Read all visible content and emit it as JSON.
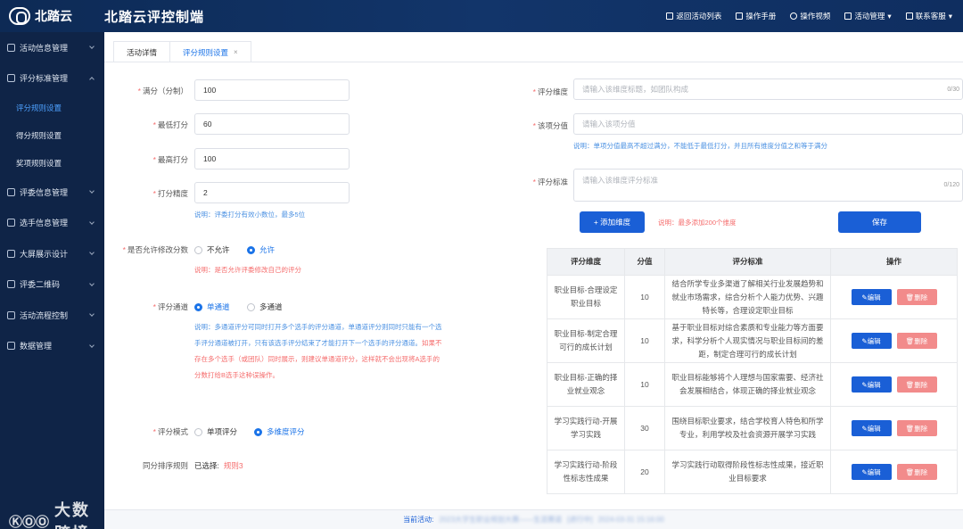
{
  "header": {
    "logo_text": "北踏云",
    "app_title": "北踏云评控制端",
    "actions": [
      {
        "label": "返回活动列表",
        "icon": "grid-icon"
      },
      {
        "label": "操作手册",
        "icon": "book-icon"
      },
      {
        "label": "操作视频",
        "icon": "play-icon"
      },
      {
        "label": "活动管理",
        "icon": "table-icon"
      },
      {
        "label": "联系客服",
        "icon": "chat-icon"
      }
    ]
  },
  "sidebar": {
    "items": [
      {
        "label": "活动信息管理"
      },
      {
        "label": "评分标准管理"
      },
      {
        "label": "评委信息管理"
      },
      {
        "label": "选手信息管理"
      },
      {
        "label": "大屏展示设计"
      },
      {
        "label": "评委二维码"
      },
      {
        "label": "活动流程控制"
      },
      {
        "label": "数据管理"
      }
    ],
    "sub_items": [
      "评分规则设置",
      "得分规则设置",
      "奖项规则设置"
    ]
  },
  "watermark": {
    "mark": "ⓀⓄⓄ",
    "text": "大数跨境"
  },
  "tabs": [
    {
      "label": "活动详情"
    },
    {
      "label": "评分规则设置",
      "close": "×"
    }
  ],
  "form": {
    "full_score": {
      "label": "满分（分制）",
      "value": "100"
    },
    "min_score": {
      "label": "最低打分",
      "value": "60"
    },
    "max_score": {
      "label": "最高打分",
      "value": "100"
    },
    "precision": {
      "label": "打分精度",
      "value": "2"
    },
    "precision_note": "说明：评委打分有效小数位，最多5位",
    "allow_modify": {
      "label": "是否允许修改分数",
      "options": [
        "不允许",
        "允许"
      ],
      "note": "说明：是否允许评委修改自己的评分"
    },
    "channel": {
      "label": "评分通道",
      "options": [
        "单通道",
        "多通道"
      ],
      "note_line1": "说明：多通道评分可同时打开多个选手的评分通道，单通道评分则同时只能有一个选",
      "note_line2": "手评分通道被打开，只有该选手评分结束了才能打开下一个选手的评分通道。",
      "note_line2_red": "如果不",
      "note_line3": "存在多个选手（或团队）同时展示，则建议单通道评分，这样就不会出现将A选手的",
      "note_line4": "分数打给B选手这种误操作。"
    },
    "mode": {
      "label": "评分模式",
      "options": [
        "单项评分",
        "多维度评分"
      ]
    },
    "tie_rule": {
      "label": "同分排序规则",
      "selected_prefix": "已选择:",
      "selected": "规则3"
    }
  },
  "dimension": {
    "name_label": "评分维度",
    "name_placeholder": "请输入该维度标题，如团队构成",
    "name_count": "0/30",
    "score_label": "该项分值",
    "score_placeholder": "请输入该项分值",
    "score_note": "说明：单项分值最高不超过满分，不能低于最低打分，并且所有维度分值之和等于满分",
    "std_label": "评分标准",
    "std_placeholder": "请输入该维度评分标准",
    "std_count": "0/120",
    "add_button": "+ 添加维度",
    "add_note": "说明：最多添加200个维度",
    "save_button": "保存"
  },
  "table": {
    "headers": [
      "评分维度",
      "分值",
      "评分标准",
      "操作"
    ],
    "edit_label": "编辑",
    "delete_label": "删除",
    "rows": [
      {
        "dimension": "职业目标-合理设定职业目标",
        "score": "10",
        "standard": "结合所学专业多渠道了解相关行业发展趋势和就业市场需求，综合分析个人能力优势、兴趣特长等，合理设定职业目标"
      },
      {
        "dimension": "职业目标-制定合理可行的成长计划",
        "score": "10",
        "standard": "基于职业目标对综合素质和专业能力等方面要求，科学分析个人现实情况与职业目标间的差距，制定合理可行的成长计划"
      },
      {
        "dimension": "职业目标-正确的择业就业观念",
        "score": "10",
        "standard": "职业目标能够将个人理想与国家需要、经济社会发展相结合，体现正确的择业就业观念"
      },
      {
        "dimension": "学习实践行动-开展学习实践",
        "score": "30",
        "standard": "围绕目标职业要求，结合学校育人特色和所学专业，利用学校及社会资源开展学习实践"
      },
      {
        "dimension": "学习实践行动-阶段性标志性成果",
        "score": "20",
        "standard": "学习实践行动取得阶段性标志性成果，接近职业目标要求"
      }
    ]
  },
  "footer": {
    "prefix": "当前活动:",
    "activity": "2023大学生职业规划大赛——生涯赛道",
    "status": "[进行中]",
    "time": "2024-03-31 15:16:00"
  }
}
